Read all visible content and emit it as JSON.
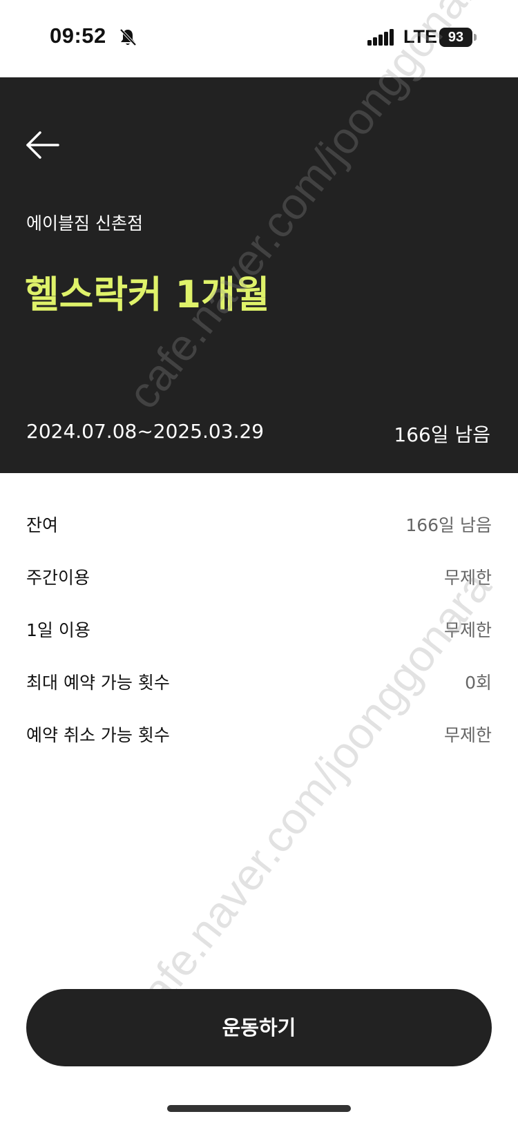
{
  "status_bar": {
    "time": "09:52",
    "network": "LTE",
    "battery": "93"
  },
  "header": {
    "gym_name": "에이블짐 신촌점",
    "membership_title": "헬스락커 1개월",
    "date_range": "2024.07.08~2025.03.29",
    "days_left": "166일 남음"
  },
  "info": [
    {
      "label": "잔여",
      "value": "166일 남음"
    },
    {
      "label": "주간이용",
      "value": "무제한"
    },
    {
      "label": "1일 이용",
      "value": "무제한"
    },
    {
      "label": "최대 예약 가능 횟수",
      "value": "0회"
    },
    {
      "label": "예약 취소 가능 횟수",
      "value": "무제한"
    }
  ],
  "cta": {
    "label": "운동하기"
  },
  "watermarks": [
    "cafe.naver.com/joonggonara",
    "cafe.naver.com/joonggonara"
  ],
  "colors": {
    "header_bg": "#222222",
    "accent": "#dff26a",
    "cta_bg": "#222222"
  }
}
